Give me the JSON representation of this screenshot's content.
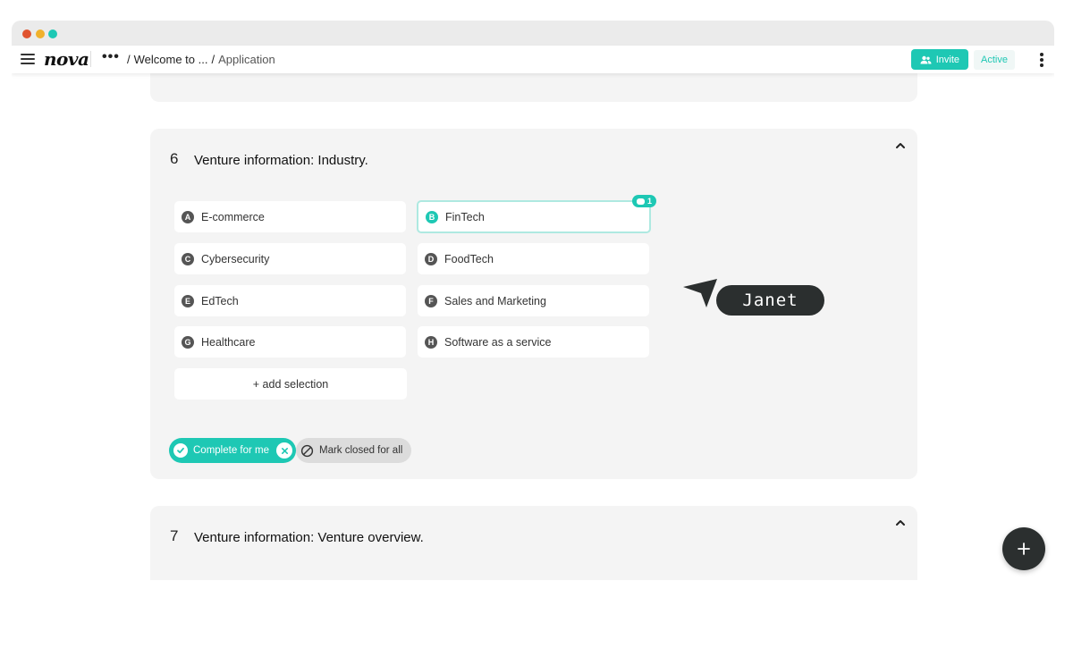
{
  "app": {
    "logo_text": "nova",
    "breadcrumb": [
      {
        "label": "Welcome to ..."
      },
      {
        "label": "Application"
      }
    ],
    "separator": "/",
    "more_label": "•••",
    "invite_label": "Invite",
    "status_label": "Active",
    "accent_color": "#1ec8b4"
  },
  "questions": [
    {
      "number": "6",
      "title": "Venture information: Industry.",
      "options": [
        {
          "letter": "A",
          "label": "E-commerce",
          "selected": false
        },
        {
          "letter": "B",
          "label": "FinTech",
          "selected": true,
          "comment_count": "1"
        },
        {
          "letter": "C",
          "label": "Cybersecurity",
          "selected": false
        },
        {
          "letter": "D",
          "label": "FoodTech",
          "selected": false
        },
        {
          "letter": "E",
          "label": "EdTech",
          "selected": false
        },
        {
          "letter": "F",
          "label": "Sales and Marketing",
          "selected": false
        },
        {
          "letter": "G",
          "label": "Healthcare",
          "selected": false
        },
        {
          "letter": "H",
          "label": "Software as a service",
          "selected": false
        }
      ],
      "add_selection_label": "+ add selection",
      "complete_label": "Complete for me",
      "mark_closed_label": "Mark closed for all"
    },
    {
      "number": "7",
      "title": "Venture information: Venture overview."
    }
  ],
  "collaborator_cursor": {
    "name": "Janet"
  },
  "icons": {
    "menu": "hamburger-icon",
    "invite": "people-add-icon",
    "kebab": "vertical-dots-icon",
    "collapse": "chevron-up-icon",
    "check": "check-circle-icon",
    "close": "close-circle-icon",
    "block": "block-icon",
    "comment": "comment-icon",
    "cursor": "cursor-arrow-icon",
    "add": "plus-icon"
  }
}
